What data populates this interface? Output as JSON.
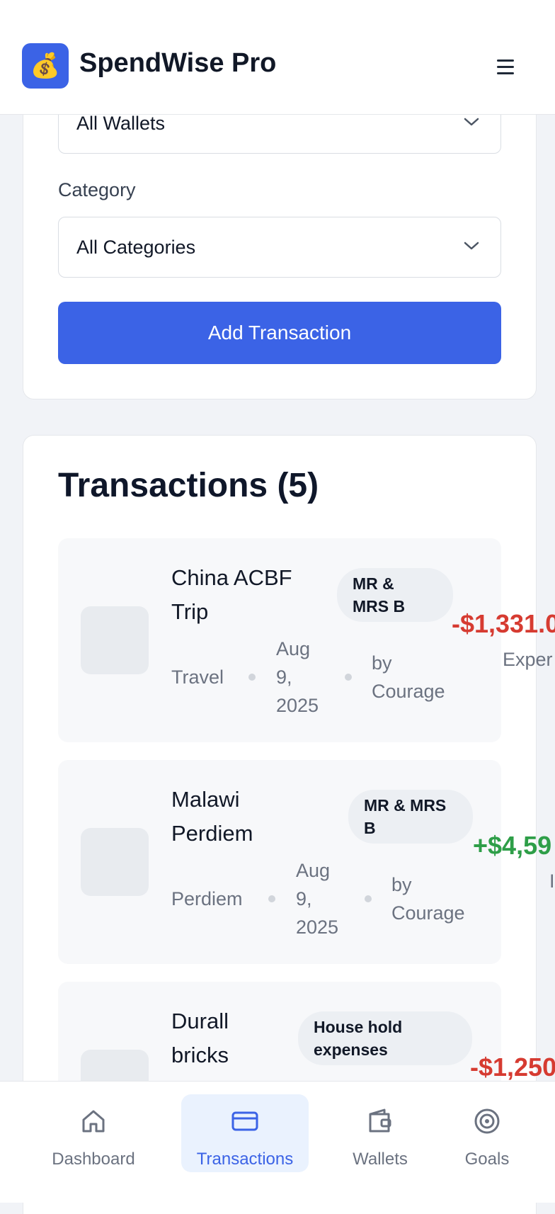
{
  "app": {
    "title": "SpendWise Pro",
    "logo_glyph": "💰"
  },
  "filters": {
    "wallet": {
      "value": "All Wallets"
    },
    "category": {
      "label": "Category",
      "value": "All Categories"
    },
    "add_button": "Add Transaction"
  },
  "transactions": {
    "title": "Transactions (5)",
    "items": [
      {
        "name_line1": "China ACBF",
        "name_line2": "Trip",
        "wallet_line1": "MR &",
        "wallet_line2": "MRS B",
        "category": "Travel",
        "date_line1": "Aug",
        "date_line2": "9,",
        "date_line3": "2025",
        "by_line1": "by",
        "by_line2": "Courage",
        "amount": "-$1,331.0",
        "kind": "Exper"
      },
      {
        "name_line1": "Malawi",
        "name_line2": "Perdiem",
        "wallet_line1": "MR & MRS",
        "wallet_line2": "B",
        "category": "Perdiem",
        "date_line1": "Aug",
        "date_line2": "9,",
        "date_line3": "2025",
        "by_line1": "by",
        "by_line2": "Courage",
        "amount": "+$4,59",
        "kind": "I"
      },
      {
        "name_line1": "Durall",
        "name_line2": "bricks",
        "wallet_line1": "House hold",
        "wallet_line2": "expenses",
        "amount": "-$1,250"
      }
    ]
  },
  "nav": {
    "items": [
      {
        "label": "Dashboard",
        "icon": "home-icon"
      },
      {
        "label": "Transactions",
        "icon": "card-icon"
      },
      {
        "label": "Wallets",
        "icon": "wallet-icon"
      },
      {
        "label": "Goals",
        "icon": "target-icon"
      }
    ]
  },
  "colors": {
    "accent": "#3b63e6",
    "expense": "#d63b31",
    "income": "#2e9e48",
    "nav_active_bg": "#eaf2fe"
  }
}
